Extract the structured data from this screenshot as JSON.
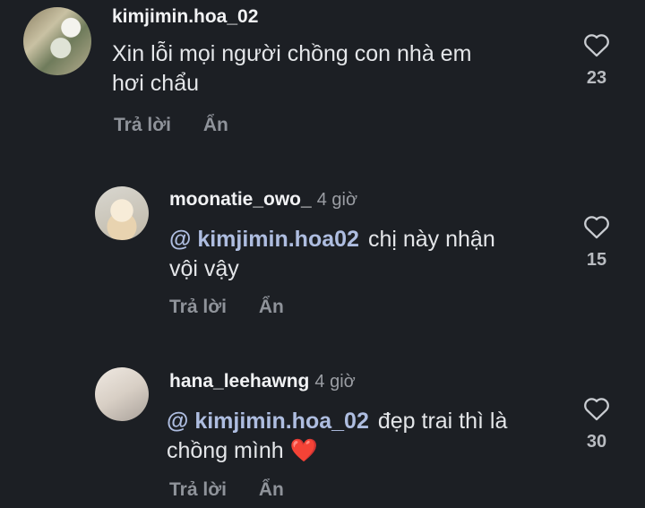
{
  "comments": [
    {
      "username": "kimjimin.hoa_02",
      "time": "",
      "mention": "",
      "text_line1": "Xin lỗi mọi người chồng con nhà em",
      "text_line2": "hơi chẩu",
      "reply_label": "Trả lời",
      "hide_label": "Ẩn",
      "like_count": "23"
    },
    {
      "username": "moonatie_owo_",
      "time": "4 giờ",
      "mention": "@ kimjimin.hoa02",
      "text_line1": "chị này nhận",
      "text_line2": "vội vậy",
      "reply_label": "Trả lời",
      "hide_label": "Ẩn",
      "like_count": "15"
    },
    {
      "username": "hana_leehawng",
      "time": "4 giờ",
      "mention": "@ kimjimin.hoa_02",
      "text_line1": "đẹp trai thì là",
      "text_line2": "chồng mình",
      "text_emoji": "❤️",
      "reply_label": "Trả lời",
      "hide_label": "Ẩn",
      "like_count": "30"
    }
  ],
  "icons": {
    "like": "heart-outline-icon"
  },
  "colors": {
    "background": "#1c1f24",
    "mention": "#aebde0",
    "heart": "#e0313d"
  }
}
